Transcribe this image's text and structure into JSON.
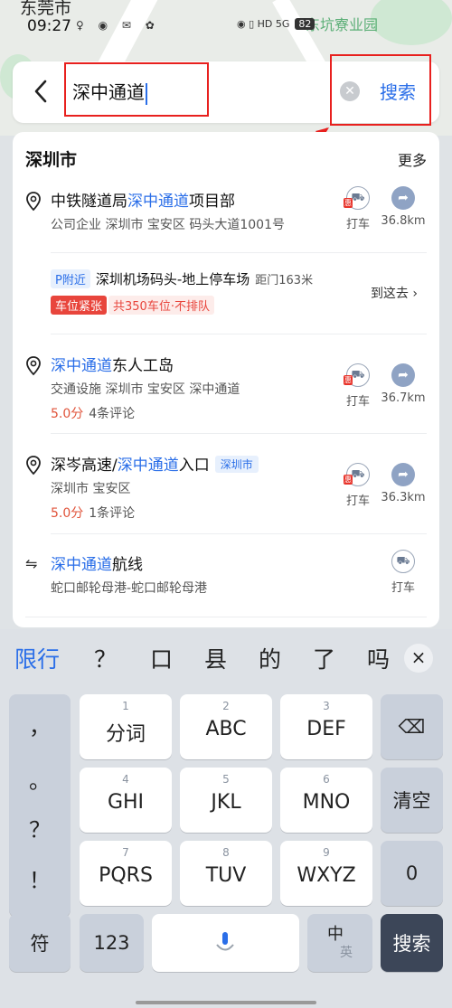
{
  "status": {
    "city": "东莞市",
    "time": "09:27",
    "icons_left": "♀ ◉ ✉ ✿",
    "icons_right": "◉ ▯ HD 5G",
    "poi": "东坑寮业园",
    "battery": "82"
  },
  "search": {
    "value": "深中通道",
    "go_label": "搜索"
  },
  "panel": {
    "title": "深圳市",
    "more": "更多",
    "taxi_label": "打车",
    "taxi_badge": "惠",
    "items": [
      {
        "pre": "中铁隧道局",
        "hit": "深中通道",
        "post": "项目部",
        "sub": "公司企业  深圳市 宝安区 码头大道1001号",
        "dist": "36.8km"
      },
      {
        "pre": "",
        "hit": "深中通道",
        "post": "东人工岛",
        "sub": "交通设施  深圳市 宝安区 深中通道",
        "score": "5.0分",
        "reviews": "4条评论",
        "dist": "36.7km"
      },
      {
        "pre": "深岑高速/",
        "hit": "深中通道",
        "post": "入口",
        "tag": "深圳市",
        "sub": "深圳市 宝安区",
        "score": "5.0分",
        "reviews": "1条评论",
        "dist": "36.3km"
      },
      {
        "pre": "",
        "hit": "深中通道",
        "post": "航线",
        "sub": "蛇口邮轮母港-蛇口邮轮母港"
      }
    ],
    "parking": {
      "badge": "P附近",
      "name": "深圳机场码头-地上停车场",
      "distance": "距门163米",
      "go_here": "到这去 ›",
      "status": "车位紧张",
      "count": "共350车位·不排队"
    }
  },
  "keyboard": {
    "candidates": [
      "限行",
      "？",
      "口",
      "县",
      "的",
      "了",
      "吗"
    ],
    "close": "×",
    "punct": [
      "，",
      "。",
      "？",
      "！"
    ],
    "keys": [
      {
        "n": "1",
        "t": "分词"
      },
      {
        "n": "2",
        "t": "ABC"
      },
      {
        "n": "3",
        "t": "DEF"
      },
      {
        "n": "4",
        "t": "GHI"
      },
      {
        "n": "5",
        "t": "JKL"
      },
      {
        "n": "6",
        "t": "MNO"
      },
      {
        "n": "7",
        "t": "PQRS"
      },
      {
        "n": "8",
        "t": "TUV"
      },
      {
        "n": "9",
        "t": "WXYZ"
      }
    ],
    "backspace": "⌫",
    "clear": "清空",
    "zero": "0",
    "symbol": "符",
    "num": "123",
    "lang_main": "中",
    "lang_sub": "英",
    "search": "搜索"
  }
}
